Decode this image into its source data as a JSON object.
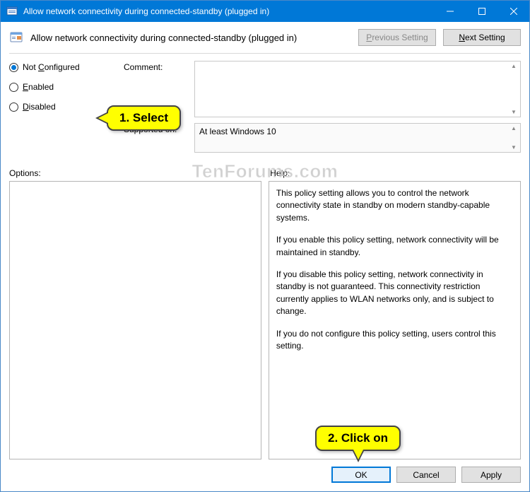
{
  "titlebar": {
    "title": "Allow network connectivity during connected-standby (plugged in)"
  },
  "header": {
    "title": "Allow network connectivity during connected-standby (plugged in)",
    "previous_setting": "Previous Setting",
    "next_setting": "Next Setting"
  },
  "radios": {
    "not_configured": "Not Configured",
    "enabled": "Enabled",
    "disabled": "Disabled",
    "selected": "not_configured"
  },
  "fields": {
    "comment_label": "Comment:",
    "comment_value": "",
    "supported_label": "Supported on:",
    "supported_value": "At least Windows 10"
  },
  "panels": {
    "options_label": "Options:",
    "options_content": "",
    "help_label": "Help:",
    "help_paragraphs": [
      "This policy setting allows you to control the network connectivity state in standby on modern standby-capable systems.",
      "If you enable this policy setting, network connectivity will be maintained in standby.",
      "If you disable this policy setting, network connectivity in standby is not guaranteed. This connectivity restriction currently applies to WLAN networks only, and is subject to change.",
      "If you do not configure this policy setting, users control this setting."
    ]
  },
  "footer": {
    "ok": "OK",
    "cancel": "Cancel",
    "apply": "Apply"
  },
  "callouts": {
    "c1": "1. Select",
    "c2": "2. Click on"
  },
  "watermark": "TenForums.com"
}
